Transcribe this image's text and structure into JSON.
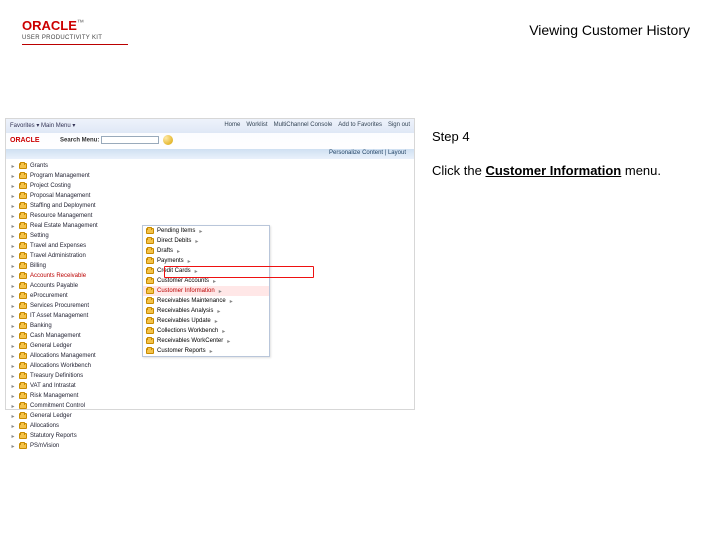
{
  "brand": {
    "name": "ORACLE",
    "suffix": "™",
    "subtitle": "USER PRODUCTIVITY KIT"
  },
  "topic_title": "Viewing Customer History",
  "instruction": {
    "step_label": "Step 4",
    "prefix": "Click the ",
    "target": "Customer Information",
    "suffix": " menu."
  },
  "app": {
    "strip_left": "Favorites ▾   Main Menu ▾",
    "nav": [
      "Home",
      "Worklist",
      "MultiChannel Console",
      "Add to Favorites",
      "Sign out"
    ],
    "search_label": "Search Menu:",
    "personalize": "Personalize Content | Layout",
    "tree": [
      "Grants",
      "Program Management",
      "Project Costing",
      "Proposal Management",
      "Staffing and Deployment",
      "Resource Management",
      "Real Estate Management",
      "Setting",
      "Travel and Expenses",
      "Travel Administration",
      "Billing",
      "Accounts Receivable",
      "Accounts Payable",
      "eProcurement",
      "Services Procurement",
      "IT Asset Management",
      "Banking",
      "Cash Management",
      "General Ledger",
      "Allocations Management",
      "Allocations Workbench",
      "Treasury Definitions",
      "VAT and Intrastat",
      "Risk Management",
      "Commitment Control",
      "General Ledger",
      "Allocations",
      "Statutory Reports",
      "PS/nVision"
    ],
    "tree_hot_index": 11,
    "flyout": [
      "Pending Items",
      "Direct Debits",
      "Drafts",
      "Payments",
      "Credit Cards",
      "Customer Accounts",
      "Customer Information",
      "Receivables Maintenance",
      "Receivables Analysis",
      "Receivables Update",
      "Collections Workbench",
      "Receivables WorkCenter",
      "Customer Reports"
    ],
    "flyout_hot_index": 6
  }
}
